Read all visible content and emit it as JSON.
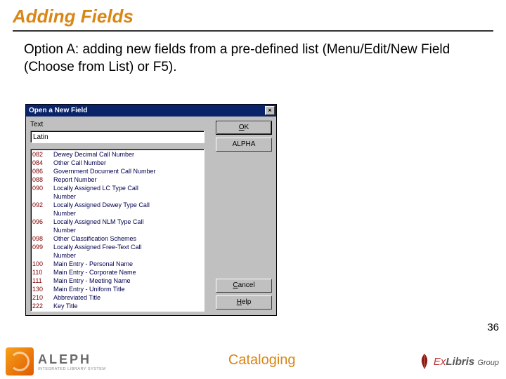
{
  "slide": {
    "title": "Adding Fields",
    "body": "Option A: adding new fields from a pre-defined list (Menu/Edit/New Field (Choose from List) or F5).",
    "page_number": "36",
    "footer_center": "Cataloging"
  },
  "dialog": {
    "title": "Open a New Field",
    "field_label": "Text",
    "input_value": "Latin",
    "buttons": {
      "ok": "OK",
      "alpha": "ALPHA",
      "cancel": "Cancel",
      "help": "Help"
    },
    "list": [
      {
        "code": "082",
        "desc": "Dewey Decimal Call Number"
      },
      {
        "code": "084",
        "desc": "Other Call Number"
      },
      {
        "code": "086",
        "desc": "Government Document Call Number"
      },
      {
        "code": "088",
        "desc": "Report Number"
      },
      {
        "code": "090",
        "desc": "Locally Assigned LC Type Call"
      },
      {
        "code": "",
        "desc": "Number",
        "cont": true
      },
      {
        "code": "092",
        "desc": "Locally Assigned Dewey Type Call"
      },
      {
        "code": "",
        "desc": "Number",
        "cont": true
      },
      {
        "code": "096",
        "desc": "Locally Assigned NLM Type Call"
      },
      {
        "code": "",
        "desc": "Number",
        "cont": true
      },
      {
        "code": "098",
        "desc": "Other Classification Schemes"
      },
      {
        "code": "099",
        "desc": "Locally Assigned Free-Text Call"
      },
      {
        "code": "",
        "desc": "Number",
        "cont": true
      },
      {
        "code": "100",
        "desc": "Main Entry - Personal Name"
      },
      {
        "code": "110",
        "desc": "Main Entry - Corporate Name"
      },
      {
        "code": "111",
        "desc": "Main Entry - Meeting Name"
      },
      {
        "code": "130",
        "desc": "Main Entry - Uniform Title"
      },
      {
        "code": "210",
        "desc": "Abbreviated Title"
      },
      {
        "code": "222",
        "desc": "Key Title"
      }
    ]
  },
  "brand": {
    "aleph": "ALEPH",
    "aleph_sub": "INTEGRATED LIBRARY SYSTEM",
    "exlibris_prefix": "Ex",
    "exlibris_main": "Libris",
    "exlibris_suffix": "Group"
  }
}
